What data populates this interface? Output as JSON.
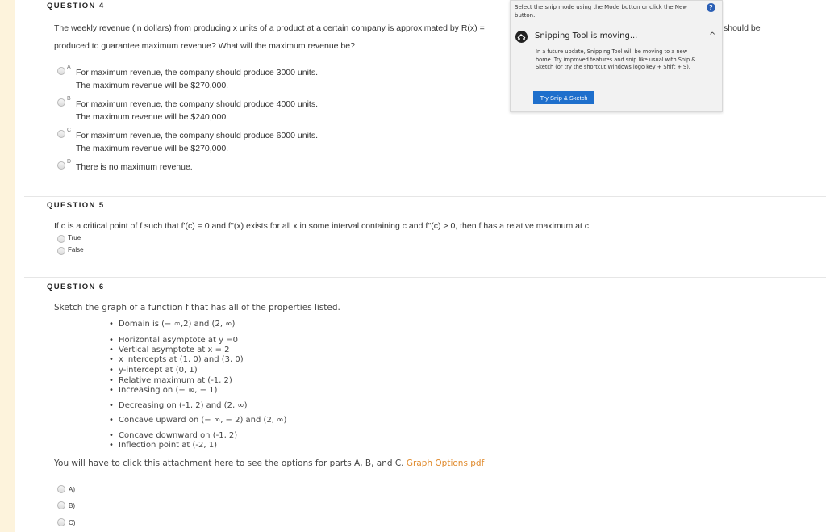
{
  "q4": {
    "header": "QUESTION 4",
    "stem_line1": "The weekly revenue (in dollars) from producing x units of a product at a certain company is approximated by R(x) =",
    "stem_fragment": "should be",
    "stem_line2": "produced to guarantee maximum revenue? What will the maximum revenue be?",
    "options": [
      {
        "letter": "A",
        "line1": "For maximum revenue, the company should produce 3000 units.",
        "line2": "The maximum revenue will be $270,000."
      },
      {
        "letter": "B",
        "line1": "For maximum revenue, the company should produce 4000 units.",
        "line2": "The maximum revenue will be $240,000."
      },
      {
        "letter": "C",
        "line1": "For maximum revenue, the company should produce 6000 units.",
        "line2": "The maximum revenue will be $270,000."
      },
      {
        "letter": "D",
        "line1": "There is no maximum revenue.",
        "line2": ""
      }
    ]
  },
  "q5": {
    "header": "QUESTION 5",
    "stem": "If c is a critical point of f such that f'(c) = 0 and f''(x) exists for all x in some interval containing c and f''(c) > 0, then f has a relative maximum at c.",
    "options": [
      "True",
      "False"
    ]
  },
  "q6": {
    "header": "QUESTION 6",
    "stem": "Sketch the graph of a function f that has all of the properties listed.",
    "properties": [
      "Domain is (− ∞,2) and (2, ∞)",
      "Horizontal asymptote at y =0",
      "Vertical asymptote at x = 2",
      "x intercepts at (1, 0) and (3, 0)",
      "y-intercept at (0, 1)",
      "Relative maximum at (-1, 2)",
      "Increasing on (− ∞, − 1)",
      "Decreasing on (-1, 2) and (2, ∞)",
      "Concave upward on (− ∞, − 2) and (2, ∞)",
      "Concave downward on (-1, 2)",
      "Inflection point at (-2, 1)"
    ],
    "attachment_text": "You will have to click this attachment here to see the options for parts A, B, and C.",
    "attachment_link": "Graph Options.pdf",
    "options": [
      "A)",
      "B)",
      "C)"
    ]
  },
  "snip": {
    "top_text": "Select the snip mode using the Mode button or click the New button.",
    "help_label": "?",
    "title": "Snipping Tool is moving...",
    "chevron": "^",
    "body": "In a future update, Snipping Tool will be moving to a new home. Try improved features and snip like usual with Snip & Sketch (or try the shortcut Windows logo key + Shift + S).",
    "button": "Try Snip & Sketch",
    "colors": {
      "button": "#1e6fcc",
      "help": "#2b5fb5"
    }
  },
  "colors": {
    "accent_strip": "#fdf3dc",
    "link": "#e08a2c"
  }
}
